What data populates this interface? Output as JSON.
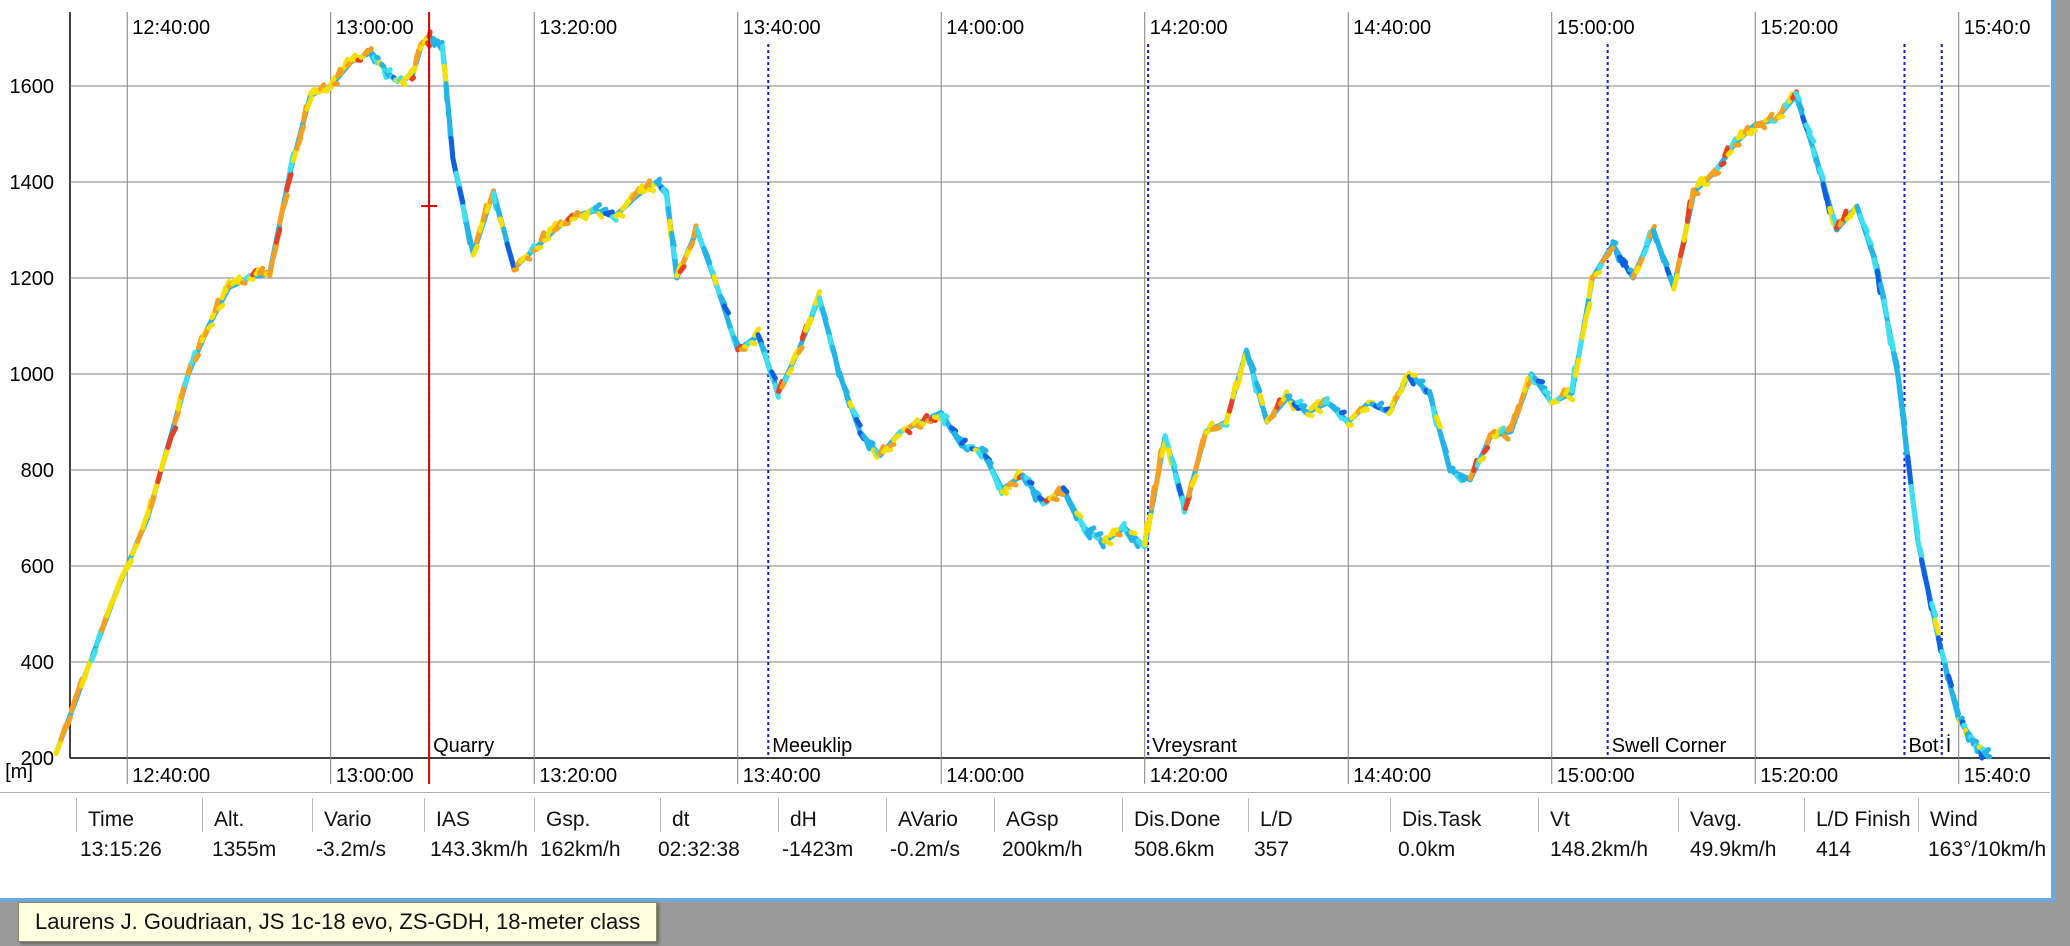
{
  "chart_data": {
    "type": "line",
    "title": "",
    "xlabel": "",
    "ylabel": "t [m]",
    "ylim": [
      200,
      1700
    ],
    "y_ticks": [
      "1600",
      "1400",
      "1200",
      "1000",
      "800",
      "600",
      "400",
      "200"
    ],
    "x_ticks": [
      "12:40:00",
      "13:00:00",
      "13:20:00",
      "13:40:00",
      "14:00:00",
      "14:20:00",
      "14:40:00",
      "15:00:00",
      "15:20:00",
      "15:40:0"
    ],
    "grid": true,
    "cursor_time": "13:09:40",
    "series": [
      {
        "x": [
          "12:33:00",
          "12:36:00",
          "12:39:00",
          "12:42:00",
          "12:44:00",
          "12:46:00",
          "12:48:00",
          "12:50:00",
          "12:52:00",
          "12:54:00",
          "12:56:00",
          "12:58:00",
          "13:00:00",
          "13:02:00",
          "13:04:00",
          "13:05:30",
          "13:06:30",
          "13:08:00",
          "13:09:00",
          "13:10:00",
          "13:11:00",
          "13:12:00",
          "13:14:00",
          "13:16:00",
          "13:18:00",
          "13:20:00",
          "13:22:00",
          "13:24:00",
          "13:26:00",
          "13:28:00",
          "13:30:00",
          "13:32:00",
          "13:33:00",
          "13:34:00",
          "13:36:00",
          "13:38:00",
          "13:40:00",
          "13:42:00",
          "13:44:00",
          "13:46:00",
          "13:48:00",
          "13:50:00",
          "13:52:00",
          "13:54:00",
          "13:56:00",
          "13:58:00",
          "14:00:00",
          "14:02:00",
          "14:04:00",
          "14:06:00",
          "14:08:00",
          "14:10:00",
          "14:12:00",
          "14:14:00",
          "14:16:00",
          "14:18:00",
          "14:20:00",
          "14:22:00",
          "14:24:00",
          "14:26:00",
          "14:28:00",
          "14:30:00",
          "14:32:00",
          "14:34:00",
          "14:36:00",
          "14:38:00",
          "14:40:00",
          "14:42:00",
          "14:44:00",
          "14:46:00",
          "14:48:00",
          "14:50:00",
          "14:52:00",
          "14:54:00",
          "14:56:00",
          "14:58:00",
          "15:00:00",
          "15:02:00",
          "15:04:00",
          "15:06:00",
          "15:08:00",
          "15:10:00",
          "15:12:00",
          "15:14:00",
          "15:16:00",
          "15:18:00",
          "15:20:00",
          "15:22:00",
          "15:24:00",
          "15:26:00",
          "15:28:00",
          "15:30:00",
          "15:32:00",
          "15:34:00",
          "15:36:00",
          "15:38:00",
          "15:40:00",
          "15:41:00",
          "15:42:00",
          "15:43:00"
        ],
        "y": [
          210,
          380,
          550,
          700,
          850,
          1000,
          1100,
          1180,
          1200,
          1210,
          1420,
          1580,
          1600,
          1650,
          1670,
          1630,
          1610,
          1620,
          1690,
          1700,
          1680,
          1450,
          1250,
          1380,
          1220,
          1260,
          1300,
          1330,
          1340,
          1330,
          1370,
          1400,
          1380,
          1200,
          1300,
          1180,
          1050,
          1080,
          960,
          1050,
          1160,
          1000,
          880,
          830,
          880,
          900,
          920,
          850,
          840,
          760,
          790,
          730,
          760,
          680,
          650,
          680,
          640,
          870,
          720,
          880,
          900,
          1050,
          900,
          950,
          920,
          940,
          900,
          940,
          920,
          1000,
          960,
          800,
          780,
          870,
          880,
          1000,
          940,
          960,
          1200,
          1270,
          1200,
          1300,
          1180,
          1380,
          1420,
          1480,
          1520,
          1530,
          1580,
          1450,
          1300,
          1350,
          1220,
          1000,
          650,
          450,
          280,
          250,
          220,
          200
        ]
      }
    ],
    "waypoints": [
      {
        "label": "Quarry",
        "x": "13:09:40"
      },
      {
        "label": "Meeuklip",
        "x": "13:43:00"
      },
      {
        "label": "Vreysrant",
        "x": "14:20:20"
      },
      {
        "label": "Swell Corner",
        "x": "15:05:30"
      },
      {
        "label": "Bot",
        "x": "15:34:40"
      },
      {
        "label": "İ",
        "x": "15:38:20"
      }
    ],
    "colors": {
      "grid": "#808080",
      "axis": "#000000",
      "cursor": "#e00000",
      "waypoint": "#1a1ad0",
      "trace_palette": [
        "#1060e0",
        "#25b4e8",
        "#40e0f0",
        "#f5e000",
        "#f5a020",
        "#e84020"
      ]
    }
  },
  "stats": {
    "columns": [
      {
        "header": "",
        "value": ""
      },
      {
        "header": "Time",
        "value": "13:15:26"
      },
      {
        "header": "Alt.",
        "value": "1355m"
      },
      {
        "header": "Vario",
        "value": "-3.2m/s"
      },
      {
        "header": "IAS",
        "value": "143.3km/h"
      },
      {
        "header": "Gsp.",
        "value": "162km/h"
      },
      {
        "header": "dt",
        "value": "02:32:38"
      },
      {
        "header": "dH",
        "value": "-1423m"
      },
      {
        "header": "AVario",
        "value": "-0.2m/s"
      },
      {
        "header": "AGsp",
        "value": "200km/h"
      },
      {
        "header": "Dis.Done",
        "value": "508.6km"
      },
      {
        "header": "L/D",
        "value": "357"
      },
      {
        "header": "Dis.Task",
        "value": "0.0km"
      },
      {
        "header": "Vt",
        "value": "148.2km/h"
      },
      {
        "header": "Vavg.",
        "value": "49.9km/h"
      },
      {
        "header": "L/D Finish",
        "value": "414"
      },
      {
        "header": "Wind",
        "value": "163°/10km/h"
      }
    ]
  },
  "tooltip": {
    "text": "Laurens J. Goudriaan, JS 1c-18 evo, ZS-GDH, 18-meter class"
  }
}
